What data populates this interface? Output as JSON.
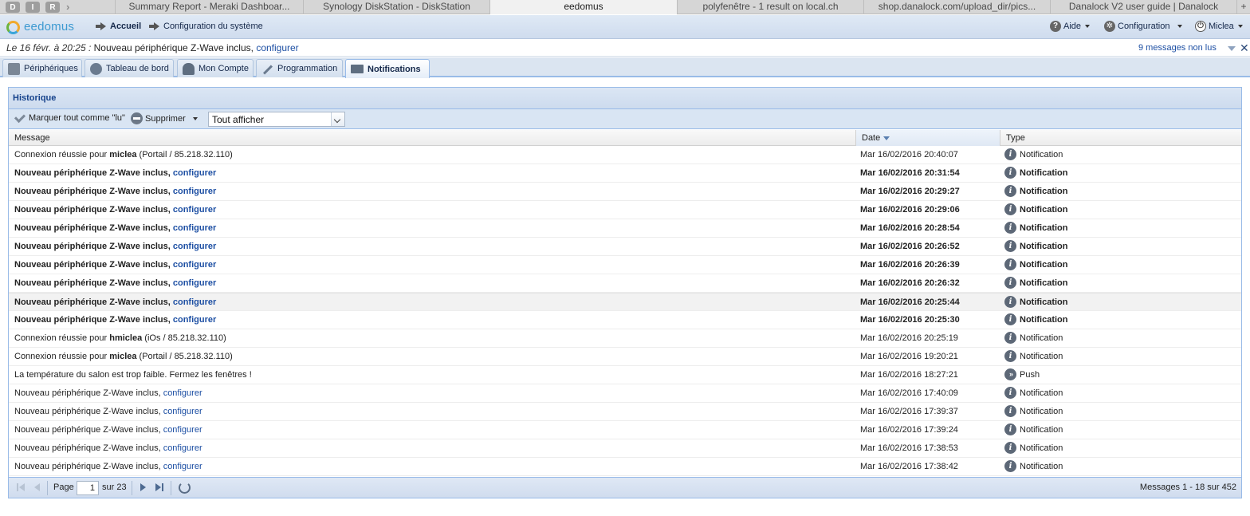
{
  "browser": {
    "ext_buttons": [
      "D",
      "I",
      "R"
    ],
    "tabs": [
      {
        "label": "Summary Report - Meraki Dashboar...",
        "active": false
      },
      {
        "label": "Synology DiskStation - DiskStation",
        "active": false
      },
      {
        "label": "eedomus",
        "active": true
      },
      {
        "label": "polyfenêtre - 1 result on local.ch",
        "active": false
      },
      {
        "label": "shop.danalock.com/upload_dir/pics...",
        "active": false
      },
      {
        "label": "Danalock V2 user guide | Danalock",
        "active": false
      }
    ],
    "new_tab": "+"
  },
  "header": {
    "logo": "eedomus",
    "nav_home": "Accueil",
    "nav_config_system": "Configuration du système",
    "help": "Aide",
    "configuration": "Configuration",
    "user": "Miclea"
  },
  "banner": {
    "date": "Le 16 févr. à 20:25 :",
    "text": "Nouveau périphérique Z-Wave inclus,",
    "link": "configurer",
    "unread": "9 messages non lus"
  },
  "module_tabs": [
    {
      "label": "Périphériques",
      "icon": "cube-icon",
      "active": false
    },
    {
      "label": "Tableau de bord",
      "icon": "dashboard-icon",
      "active": false
    },
    {
      "label": "Mon Compte",
      "icon": "user-icon",
      "active": false
    },
    {
      "label": "Programmation",
      "icon": "wand-icon",
      "active": false
    },
    {
      "label": "Notifications",
      "icon": "mail-icon",
      "active": true
    }
  ],
  "panel": {
    "title": "Historique",
    "mark_all_read": "Marquer tout comme \"lu\"",
    "delete": "Supprimer",
    "filter_value": "Tout afficher",
    "columns": {
      "message": "Message",
      "date": "Date",
      "type": "Type"
    }
  },
  "rows": [
    {
      "pre": "Connexion réussie pour ",
      "strong": "miclea",
      "post": " (Portail / 85.218.32.110)",
      "link": "",
      "date": "Mar 16/02/2016 20:40:07",
      "type": "Notification",
      "icon": "info",
      "unread": false
    },
    {
      "pre": "Nouveau périphérique Z-Wave inclus, ",
      "strong": "",
      "post": "",
      "link": "configurer",
      "date": "Mar 16/02/2016 20:31:54",
      "type": "Notification",
      "icon": "info",
      "unread": true
    },
    {
      "pre": "Nouveau périphérique Z-Wave inclus, ",
      "strong": "",
      "post": "",
      "link": "configurer",
      "date": "Mar 16/02/2016 20:29:27",
      "type": "Notification",
      "icon": "info",
      "unread": true
    },
    {
      "pre": "Nouveau périphérique Z-Wave inclus, ",
      "strong": "",
      "post": "",
      "link": "configurer",
      "date": "Mar 16/02/2016 20:29:06",
      "type": "Notification",
      "icon": "info",
      "unread": true
    },
    {
      "pre": "Nouveau périphérique Z-Wave inclus, ",
      "strong": "",
      "post": "",
      "link": "configurer",
      "date": "Mar 16/02/2016 20:28:54",
      "type": "Notification",
      "icon": "info",
      "unread": true
    },
    {
      "pre": "Nouveau périphérique Z-Wave inclus, ",
      "strong": "",
      "post": "",
      "link": "configurer",
      "date": "Mar 16/02/2016 20:26:52",
      "type": "Notification",
      "icon": "info",
      "unread": true
    },
    {
      "pre": "Nouveau périphérique Z-Wave inclus, ",
      "strong": "",
      "post": "",
      "link": "configurer",
      "date": "Mar 16/02/2016 20:26:39",
      "type": "Notification",
      "icon": "info",
      "unread": true
    },
    {
      "pre": "Nouveau périphérique Z-Wave inclus, ",
      "strong": "",
      "post": "",
      "link": "configurer",
      "date": "Mar 16/02/2016 20:26:32",
      "type": "Notification",
      "icon": "info",
      "unread": true
    },
    {
      "pre": "Nouveau périphérique Z-Wave inclus, ",
      "strong": "",
      "post": "",
      "link": "configurer",
      "date": "Mar 16/02/2016 20:25:44",
      "type": "Notification",
      "icon": "info",
      "unread": true,
      "hover": true
    },
    {
      "pre": "Nouveau périphérique Z-Wave inclus, ",
      "strong": "",
      "post": "",
      "link": "configurer",
      "date": "Mar 16/02/2016 20:25:30",
      "type": "Notification",
      "icon": "info",
      "unread": true
    },
    {
      "pre": "Connexion réussie pour ",
      "strong": "hmiclea",
      "post": " (iOs / 85.218.32.110)",
      "link": "",
      "date": "Mar 16/02/2016 20:25:19",
      "type": "Notification",
      "icon": "info",
      "unread": false
    },
    {
      "pre": "Connexion réussie pour ",
      "strong": "miclea",
      "post": " (Portail / 85.218.32.110)",
      "link": "",
      "date": "Mar 16/02/2016 19:20:21",
      "type": "Notification",
      "icon": "info",
      "unread": false
    },
    {
      "pre": "La température du salon est trop faible. Fermez les fenêtres !",
      "strong": "",
      "post": "",
      "link": "",
      "date": "Mar 16/02/2016 18:27:21",
      "type": "Push",
      "icon": "push",
      "unread": false
    },
    {
      "pre": "Nouveau périphérique Z-Wave inclus, ",
      "strong": "",
      "post": "",
      "link": "configurer",
      "date": "Mar 16/02/2016 17:40:09",
      "type": "Notification",
      "icon": "info",
      "unread": false
    },
    {
      "pre": "Nouveau périphérique Z-Wave inclus, ",
      "strong": "",
      "post": "",
      "link": "configurer",
      "date": "Mar 16/02/2016 17:39:37",
      "type": "Notification",
      "icon": "info",
      "unread": false
    },
    {
      "pre": "Nouveau périphérique Z-Wave inclus, ",
      "strong": "",
      "post": "",
      "link": "configurer",
      "date": "Mar 16/02/2016 17:39:24",
      "type": "Notification",
      "icon": "info",
      "unread": false
    },
    {
      "pre": "Nouveau périphérique Z-Wave inclus, ",
      "strong": "",
      "post": "",
      "link": "configurer",
      "date": "Mar 16/02/2016 17:38:53",
      "type": "Notification",
      "icon": "info",
      "unread": false
    },
    {
      "pre": "Nouveau périphérique Z-Wave inclus, ",
      "strong": "",
      "post": "",
      "link": "configurer",
      "date": "Mar 16/02/2016 17:38:42",
      "type": "Notification",
      "icon": "info",
      "unread": false
    }
  ],
  "pager": {
    "page_label": "Page",
    "page_value": "1",
    "of_label": "sur 23",
    "summary": "Messages 1 - 18 sur 452"
  },
  "colors": {
    "link": "#1d4fa3",
    "panel_border": "#99bbe8",
    "title": "#15428b"
  }
}
